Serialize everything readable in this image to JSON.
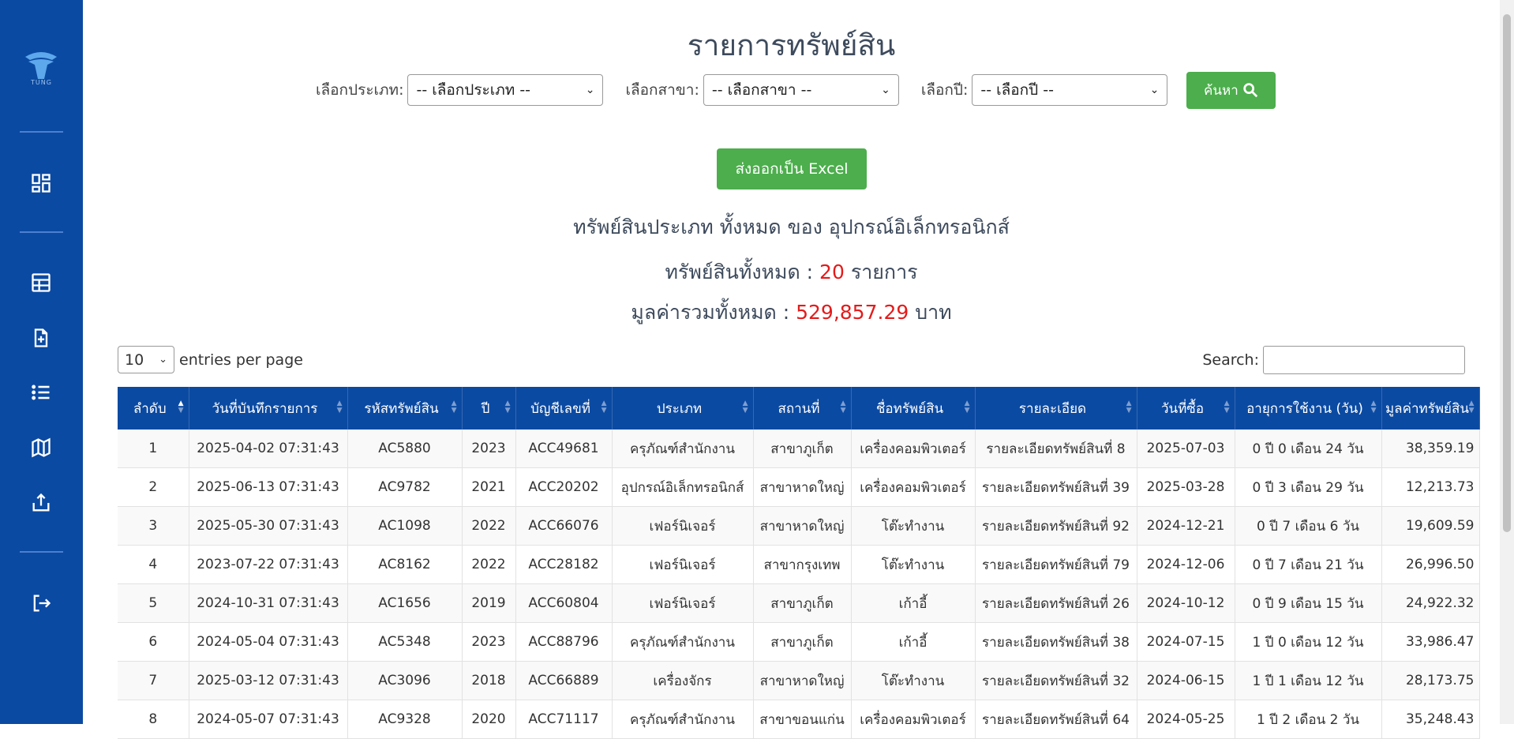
{
  "brand": {
    "logo_text": "TUNG"
  },
  "page_title": "รายการทรัพย์สิน",
  "filters": {
    "type_label": "เลือกประเภท:",
    "type_value": "-- เลือกประเภท --",
    "branch_label": "เลือกสาขา:",
    "branch_value": "-- เลือกสาขา --",
    "year_label": "เลือกปี:",
    "year_value": "-- เลือกปี --",
    "search_label": "ค้นหา"
  },
  "export_label": "ส่งออกเป็น Excel",
  "summary": {
    "heading": "ทรัพย์สินประเภท ทั้งหมด ของ อุปกรณ์อิเล็กทรอนิกส์",
    "total_prefix": "ทรัพย์สินทั้งหมด :",
    "total_count": "20",
    "total_suffix": "รายการ",
    "value_prefix": "มูลค่ารวมทั้งหมด :",
    "value_amount": "529,857.29",
    "value_suffix": "บาท"
  },
  "table_controls": {
    "page_size": "10",
    "entries_label": "entries per page",
    "search_label": "Search:"
  },
  "table": {
    "columns": [
      "ลำดับ",
      "วันที่บันทึกรายการ",
      "รหัสทรัพย์สิน",
      "ปี",
      "บัญชีเลขที่",
      "ประเภท",
      "สถานที่",
      "ชื่อทรัพย์สิน",
      "รายละเอียด",
      "วันที่ซื้อ",
      "อายุการใช้งาน (วัน)",
      "มูลค่าทรัพย์สิน"
    ],
    "rows": [
      [
        "1",
        "2025-04-02 07:31:43",
        "AC5880",
        "2023",
        "ACC49681",
        "ครุภัณฑ์สำนักงาน",
        "สาขาภูเก็ต",
        "เครื่องคอมพิวเตอร์",
        "รายละเอียดทรัพย์สินที่ 8",
        "2025-07-03",
        "0 ปี 0 เดือน 24 วัน",
        "38,359.19"
      ],
      [
        "2",
        "2025-06-13 07:31:43",
        "AC9782",
        "2021",
        "ACC20202",
        "อุปกรณ์อิเล็กทรอนิกส์",
        "สาขาหาดใหญ่",
        "เครื่องคอมพิวเตอร์",
        "รายละเอียดทรัพย์สินที่ 39",
        "2025-03-28",
        "0 ปี 3 เดือน 29 วัน",
        "12,213.73"
      ],
      [
        "3",
        "2025-05-30 07:31:43",
        "AC1098",
        "2022",
        "ACC66076",
        "เฟอร์นิเจอร์",
        "สาขาหาดใหญ่",
        "โต๊ะทำงาน",
        "รายละเอียดทรัพย์สินที่ 92",
        "2024-12-21",
        "0 ปี 7 เดือน 6 วัน",
        "19,609.59"
      ],
      [
        "4",
        "2023-07-22 07:31:43",
        "AC8162",
        "2022",
        "ACC28182",
        "เฟอร์นิเจอร์",
        "สาขากรุงเทพ",
        "โต๊ะทำงาน",
        "รายละเอียดทรัพย์สินที่ 79",
        "2024-12-06",
        "0 ปี 7 เดือน 21 วัน",
        "26,996.50"
      ],
      [
        "5",
        "2024-10-31 07:31:43",
        "AC1656",
        "2019",
        "ACC60804",
        "เฟอร์นิเจอร์",
        "สาขาภูเก็ต",
        "เก้าอี้",
        "รายละเอียดทรัพย์สินที่ 26",
        "2024-10-12",
        "0 ปี 9 เดือน 15 วัน",
        "24,922.32"
      ],
      [
        "6",
        "2024-05-04 07:31:43",
        "AC5348",
        "2023",
        "ACC88796",
        "ครุภัณฑ์สำนักงาน",
        "สาขาภูเก็ต",
        "เก้าอี้",
        "รายละเอียดทรัพย์สินที่ 38",
        "2024-07-15",
        "1 ปี 0 เดือน 12 วัน",
        "33,986.47"
      ],
      [
        "7",
        "2025-03-12 07:31:43",
        "AC3096",
        "2018",
        "ACC66889",
        "เครื่องจักร",
        "สาขาหาดใหญ่",
        "โต๊ะทำงาน",
        "รายละเอียดทรัพย์สินที่ 32",
        "2024-06-15",
        "1 ปี 1 เดือน 12 วัน",
        "28,173.75"
      ],
      [
        "8",
        "2024-05-07 07:31:43",
        "AC9328",
        "2020",
        "ACC71117",
        "ครุภัณฑ์สำนักงาน",
        "สาขาขอนแก่น",
        "เครื่องคอมพิวเตอร์",
        "รายละเอียดทรัพย์สินที่ 64",
        "2024-05-25",
        "1 ปี 2 เดือน 2 วัน",
        "35,248.43"
      ]
    ]
  },
  "colors": {
    "sidebar": "#0b4aa2",
    "header": "#0b4aa2",
    "button": "#4cae4c",
    "highlight": "#e31b1b"
  }
}
